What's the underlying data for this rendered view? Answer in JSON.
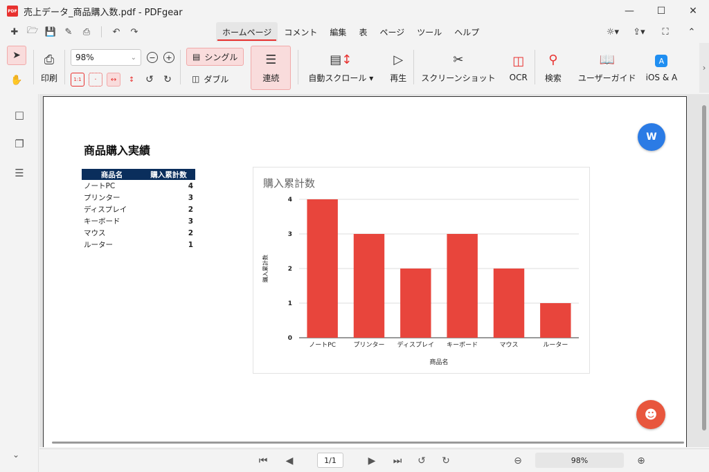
{
  "window": {
    "title": "売上データ_商品購入数.pdf - PDFgear",
    "logo": "PDF"
  },
  "menu_tabs": [
    "ホームページ",
    "コメント",
    "編集",
    "表",
    "ページ",
    "ツール",
    "ヘルプ"
  ],
  "ribbon": {
    "print": "印刷",
    "zoom_value": "98%",
    "single": "シングル",
    "double": "ダブル",
    "continuous": "連続",
    "auto_scroll": "自動スクロール",
    "play": "再生",
    "screenshot": "スクリーンショット",
    "ocr": "OCR",
    "search": "検索",
    "user_guide": "ユーザーガイド",
    "ios": "iOS & A"
  },
  "document": {
    "title": "商品購入実績",
    "table": {
      "headers": [
        "商品名",
        "購入累計数"
      ],
      "rows": [
        {
          "name": "ノートPC",
          "value": "4"
        },
        {
          "name": "プリンター",
          "value": "3"
        },
        {
          "name": "ディスプレイ",
          "value": "2"
        },
        {
          "name": "キーボード",
          "value": "3"
        },
        {
          "name": "マウス",
          "value": "2"
        },
        {
          "name": "ルーター",
          "value": "1"
        }
      ]
    }
  },
  "chart_data": {
    "type": "bar",
    "title": "購入累計数",
    "categories": [
      "ノートPC",
      "プリンター",
      "ディスプレイ",
      "キーボード",
      "マウス",
      "ルーター"
    ],
    "values": [
      4,
      3,
      2,
      3,
      2,
      1
    ],
    "xlabel": "商品名",
    "ylabel": "購入累計数",
    "ylim": [
      0,
      4
    ],
    "yticks": [
      0,
      1,
      2,
      3,
      4
    ],
    "grid": true,
    "bar_color": "#e8453c"
  },
  "status": {
    "page": "1/1",
    "zoom": "98%"
  },
  "colors": {
    "accent": "#e8312f",
    "table_header": "#0a2e5c"
  }
}
